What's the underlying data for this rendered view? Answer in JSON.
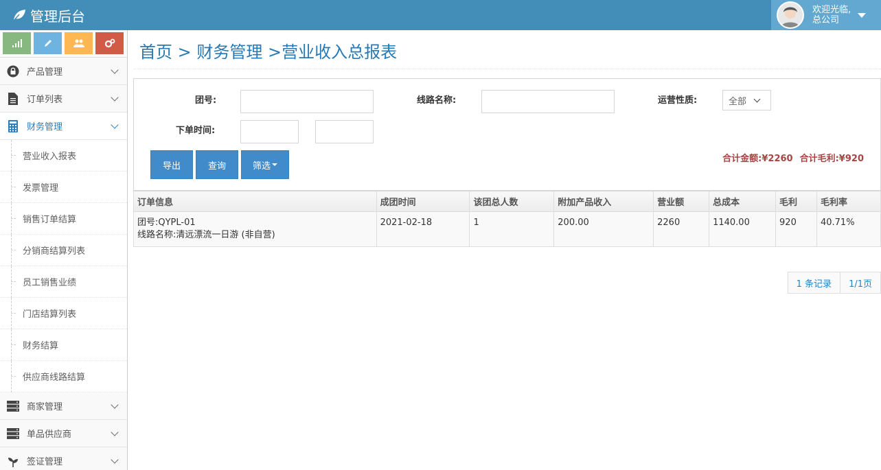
{
  "header": {
    "brand": "管理后台",
    "welcome": "欢迎光临,",
    "company": "总公司"
  },
  "sidebar": {
    "menu_top": [
      {
        "label": "产品管理",
        "icon": "lock-icon"
      },
      {
        "label": "订单列表",
        "icon": "document-icon"
      },
      {
        "label": "财务管理",
        "icon": "calculator-icon"
      }
    ],
    "finance_sub": [
      "营业收入报表",
      "发票管理",
      "销售订单结算",
      "分销商结算列表",
      "员工销售业绩",
      "门店结算列表",
      "财务结算",
      "供应商线路结算"
    ],
    "menu_bottom": [
      {
        "label": "商家管理",
        "icon": "server-icon"
      },
      {
        "label": "单品供应商",
        "icon": "server-icon"
      },
      {
        "label": "签证管理",
        "icon": "leaf-icon"
      }
    ]
  },
  "breadcrumb": "首页 > 财务管理 >营业收入总报表",
  "filters": {
    "group_no_label": "团号:",
    "route_label": "线路名称:",
    "nature_label": "运营性质:",
    "nature_value": "全部",
    "order_time_label": "下单时间:",
    "group_no_value": "",
    "route_value": "",
    "time_from": "",
    "time_to": ""
  },
  "buttons": {
    "export": "导出",
    "query": "查询",
    "filter": "筛选"
  },
  "totals": {
    "amount": "合计金额:¥2260",
    "profit": "合计毛利:¥920"
  },
  "table": {
    "headers": [
      "订单信息",
      "成团时间",
      "该团总人数",
      "附加产品收入",
      "营业额",
      "总成本",
      "毛利",
      "毛利率"
    ],
    "rows": [
      {
        "info_line1": "团号:QYPL-01",
        "info_line2": "线路名称:清远漂流一日游 (非自营)",
        "date": "2021-02-18",
        "people": "1",
        "extra_income": "200.00",
        "revenue": "2260",
        "cost": "1140.00",
        "profit": "920",
        "margin": "40.71%"
      }
    ]
  },
  "pager": {
    "records": "1 条记录",
    "pages": "1/1页"
  },
  "colors": {
    "navbar": "#438eb9",
    "accent": "#2679b5",
    "button": "#428bca",
    "totals": "#a94442"
  }
}
